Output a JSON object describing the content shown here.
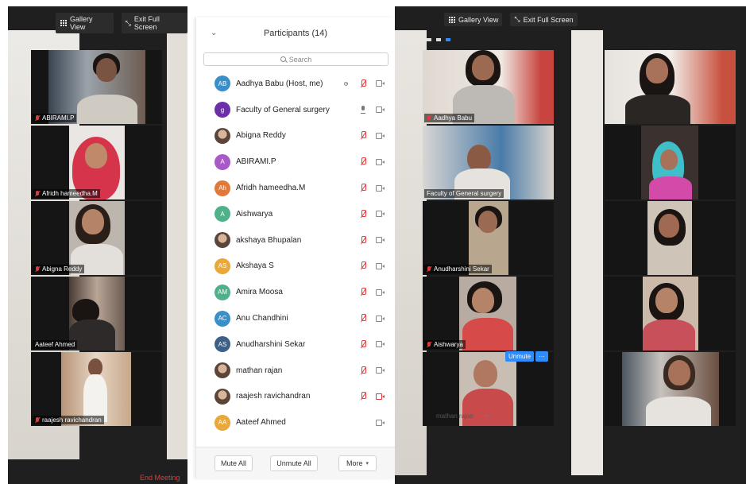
{
  "left_window": {
    "gallery_view": "Gallery View",
    "exit_full_screen": "Exit Full Screen",
    "end_meeting": "End Meeting",
    "end_meeting_partial": "ng",
    "tiles": [
      {
        "name": "ABIRAMI.P",
        "muted": true
      },
      {
        "name": "Afridh hameedha.M",
        "muted": true
      },
      {
        "name": "Abigna Reddy",
        "muted": true
      },
      {
        "name": "Aateef Ahmed",
        "muted": false
      },
      {
        "name": "raajesh ravichandran",
        "muted": true
      }
    ]
  },
  "participants": {
    "title": "Participants (14)",
    "search_placeholder": "Search",
    "list": [
      {
        "initials": "AB",
        "color": "#3a8fc8",
        "name": "Aadhya Babu (Host, me)",
        "mic": "muted",
        "cam": "on",
        "photo": false
      },
      {
        "initials": "g",
        "color": "#6b2fa8",
        "name": "Faculty of General surgery",
        "mic": "on",
        "cam": "on",
        "photo": false
      },
      {
        "initials": "",
        "color": "#5a4538",
        "name": "Abigna Reddy",
        "mic": "muted",
        "cam": "on",
        "photo": true
      },
      {
        "initials": "A",
        "color": "#a85ac8",
        "name": "ABIRAMI.P",
        "mic": "muted",
        "cam": "on",
        "photo": false
      },
      {
        "initials": "Ah",
        "color": "#e07a3a",
        "name": "Afridh hameedha.M",
        "mic": "muted",
        "cam": "on",
        "photo": false
      },
      {
        "initials": "A",
        "color": "#4fb08a",
        "name": "Aishwarya",
        "mic": "muted",
        "cam": "on",
        "photo": false
      },
      {
        "initials": "",
        "color": "#5a4538",
        "name": "akshaya Bhupalan",
        "mic": "muted",
        "cam": "on",
        "photo": true
      },
      {
        "initials": "AS",
        "color": "#e8a83a",
        "name": "Akshaya S",
        "mic": "muted",
        "cam": "on",
        "photo": false
      },
      {
        "initials": "AM",
        "color": "#4fb08a",
        "name": "Amira Moosa",
        "mic": "muted",
        "cam": "on",
        "photo": false
      },
      {
        "initials": "AC",
        "color": "#3a8fc8",
        "name": "Anu Chandhini",
        "mic": "muted",
        "cam": "on",
        "photo": false
      },
      {
        "initials": "AS",
        "color": "#3e5f86",
        "name": "Anudharshini Sekar",
        "mic": "muted",
        "cam": "on",
        "photo": false
      },
      {
        "initials": "",
        "color": "#5a4538",
        "name": "mathan rajan",
        "mic": "muted",
        "cam": "on",
        "photo": true
      },
      {
        "initials": "",
        "color": "#caa880",
        "name": "raajesh ravichandran",
        "mic": "muted",
        "cam": "off",
        "photo": true
      },
      {
        "initials": "AA",
        "color": "#e8a83a",
        "name": "Aateef Ahmed",
        "mic": "none",
        "cam": "on",
        "photo": false
      }
    ],
    "mute_all": "Mute All",
    "unmute_all": "Unmute All",
    "more": "More"
  },
  "right_window": {
    "gallery_view": "Gallery View",
    "exit_full_screen": "Exit Full Screen",
    "tiles": [
      {
        "name": "Aadhya Babu",
        "muted": true
      },
      {
        "name": "Faculty of General surgery",
        "muted": false
      },
      {
        "name": "Anudharshini Sekar",
        "muted": true
      },
      {
        "name": "Aishwarya",
        "muted": true
      },
      {
        "name": "mathan rajan",
        "muted": false
      }
    ],
    "unmute_label": "Unmute",
    "more_dots": "···"
  },
  "colors": {
    "muted_red": "#e03a3a",
    "zoom_blue": "#2d8cff",
    "active_speaker": "#9fd04c"
  }
}
